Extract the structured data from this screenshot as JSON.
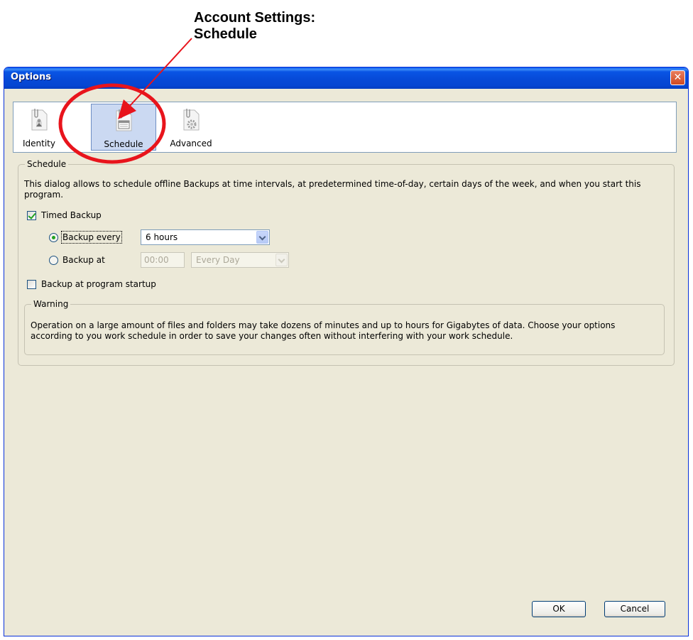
{
  "annotation": {
    "title_line1": "Account Settings:",
    "title_line2": "Schedule",
    "highlight_color": "#e8141c"
  },
  "window": {
    "title": "Options",
    "close_glyph": "✕"
  },
  "categories": [
    {
      "label": "Identity",
      "icon": "paperclip-user-icon",
      "selected": false
    },
    {
      "label": "Schedule",
      "icon": "paperclip-calendar-icon",
      "selected": true
    },
    {
      "label": "Advanced",
      "icon": "paperclip-gear-icon",
      "selected": false
    }
  ],
  "schedule": {
    "legend": "Schedule",
    "description": "This dialog allows to schedule offline Backups at time intervals, at predetermined time-of-day, certain days of the week, and when you start this program.",
    "timed_backup_label": "Timed Backup",
    "timed_backup_checked": true,
    "backup_every_label": "Backup every",
    "backup_every_selected": true,
    "backup_every_value": "6 hours",
    "backup_at_label": "Backup at",
    "backup_at_time": "00:00",
    "backup_at_days": "Every Day",
    "startup_label": "Backup at program startup",
    "startup_checked": false
  },
  "warning": {
    "legend": "Warning",
    "text": "Operation on a large amount of files and folders may take dozens of minutes and up to hours for Gigabytes of data. Choose your options according to you work schedule in order to save your changes often without interfering with your work schedule."
  },
  "buttons": {
    "ok": "OK",
    "cancel": "Cancel"
  }
}
